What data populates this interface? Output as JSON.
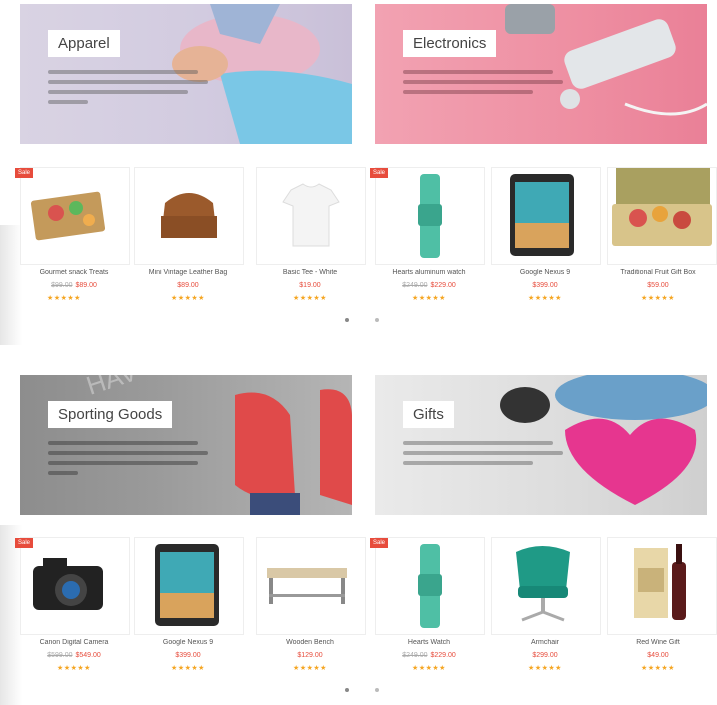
{
  "banners": [
    {
      "title": "Apparel"
    },
    {
      "title": "Electronics"
    },
    {
      "title": "Sporting Goods"
    },
    {
      "title": "Gifts"
    }
  ],
  "sections": [
    {
      "products": [
        {
          "name": "Gourmet snack Treats",
          "old_price": "$99.00",
          "price": "$89.00",
          "badge": "Sale",
          "stars": "★★★★★"
        },
        {
          "name": "Mini Vintage Leather Bag",
          "price": "$89.00",
          "stars": "★★★★★"
        },
        {
          "name": "Basic Tee - White",
          "price": "$19.00",
          "stars": "★★★★★"
        },
        {
          "name": "Hearts aluminum watch",
          "old_price": "$249.00",
          "price": "$229.00",
          "badge": "Sale",
          "stars": "★★★★★"
        },
        {
          "name": "Google Nexus 9",
          "price": "$399.00",
          "stars": "★★★★★"
        },
        {
          "name": "Traditional Fruit Gift Box",
          "price": "$59.00",
          "stars": "★★★★★"
        }
      ]
    },
    {
      "products": [
        {
          "name": "Canon Digital Camera",
          "old_price": "$599.00",
          "price": "$549.00",
          "badge": "Sale",
          "stars": "★★★★★"
        },
        {
          "name": "Google Nexus 9",
          "price": "$399.00",
          "stars": "★★★★★"
        },
        {
          "name": "Wooden Bench",
          "price": "$129.00",
          "stars": "★★★★★"
        },
        {
          "name": "Hearts Watch",
          "old_price": "$249.00",
          "price": "$229.00",
          "badge": "Sale",
          "stars": "★★★★★"
        },
        {
          "name": "Armchair",
          "price": "$299.00",
          "stars": "★★★★★"
        },
        {
          "name": "Red Wine Gift",
          "price": "$49.00",
          "stars": "★★★★★"
        }
      ]
    }
  ]
}
